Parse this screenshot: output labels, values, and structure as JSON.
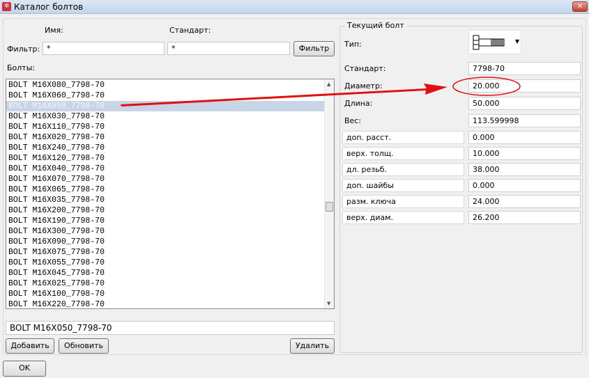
{
  "window": {
    "title": "Каталог болтов",
    "close": "✕"
  },
  "filter": {
    "name_header": "Имя:",
    "standard_header": "Стандарт:",
    "label": "Фильтр:",
    "name_value": "*",
    "standard_value": "*",
    "button": "Фильтр"
  },
  "bolts_label": "Болты:",
  "bolts": [
    "BOLT M16X080_7798-70",
    "BOLT M16X060_7798-70",
    "BOLT M16X050_7798-70",
    "BOLT M16X030_7798-70",
    "BOLT M16X110_7798-70",
    "BOLT M16X020_7798-70",
    "BOLT M16X240_7798-70",
    "BOLT M16X120_7798-70",
    "BOLT M16X040_7798-70",
    "BOLT M16X070_7798-70",
    "BOLT M16X065_7798-70",
    "BOLT M16X035_7798-70",
    "BOLT M16X200_7798-70",
    "BOLT M16X190_7798-70",
    "BOLT M16X300_7798-70",
    "BOLT M16X090_7798-70",
    "BOLT M16X075_7798-70",
    "BOLT M16X055_7798-70",
    "BOLT M16X045_7798-70",
    "BOLT M16X025_7798-70",
    "BOLT M16X100_7798-70",
    "BOLT M16X220_7798-70"
  ],
  "selected_index": 2,
  "name_input": "BOLT M16X050_7798-70",
  "buttons": {
    "add": "Добавить",
    "update": "Обновить",
    "delete": "Удалить",
    "ok": "OK"
  },
  "current": {
    "group_title": "Текущий болт",
    "type_label": "Тип:",
    "fields": [
      {
        "label": "Стандарт:",
        "value": "7798-70"
      },
      {
        "label": "Диаметр:",
        "value": "20.000"
      },
      {
        "label": "Длина:",
        "value": "50.000"
      },
      {
        "label": "Вес:",
        "value": "113.599998"
      }
    ],
    "params": [
      {
        "label": "доп. расст.",
        "value": "0.000"
      },
      {
        "label": "верх. толщ.",
        "value": "10.000"
      },
      {
        "label": "дл. резьб.",
        "value": "38.000"
      },
      {
        "label": "доп. шайбы",
        "value": "0.000"
      },
      {
        "label": "разм. ключа",
        "value": "24.000"
      },
      {
        "label": "верх. диам.",
        "value": "26.200"
      }
    ]
  },
  "colors": {
    "annotation": "#e01010",
    "selection": "#c7d5e7"
  }
}
